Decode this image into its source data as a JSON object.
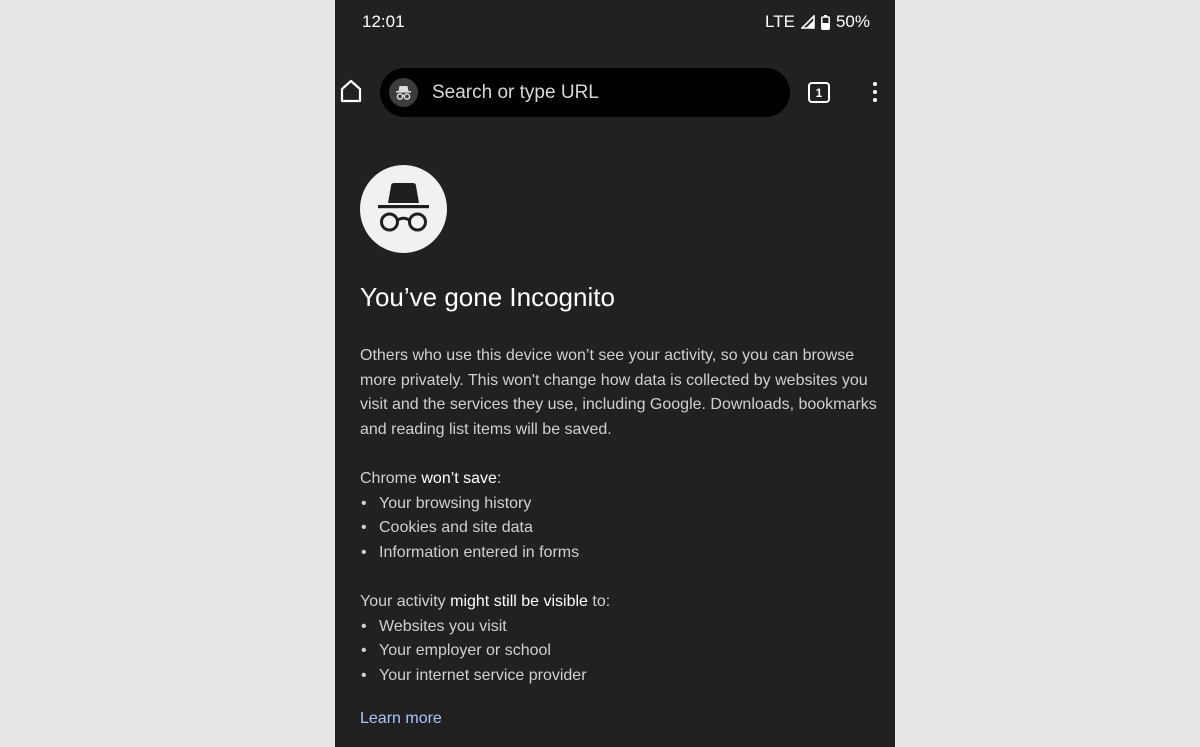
{
  "status_bar": {
    "time": "12:01",
    "network": "LTE",
    "battery": "50%",
    "icons": [
      "signal-icon",
      "battery-icon"
    ]
  },
  "toolbar": {
    "search_placeholder": "Search or type URL",
    "tab_count": "1",
    "icons": [
      "home-icon",
      "incognito-icon",
      "tab-switcher-icon",
      "more-vert-icon"
    ]
  },
  "incognito": {
    "title": "You’ve gone Incognito",
    "description": "Others who use this device won’t see your activity, so you can browse more privately. This won't change how data is collected by websites you visit and the services they use, including Google. Downloads, bookmarks and reading list items will be saved.",
    "wont_save": {
      "prefix": "Chrome ",
      "emphasis": "won’t save",
      "suffix": ":",
      "items": [
        "Your browsing history",
        "Cookies and site data",
        "Information entered in forms"
      ]
    },
    "might_be_visible": {
      "prefix": "Your activity ",
      "emphasis": "might still be visible",
      "suffix": " to:",
      "items": [
        "Websites you visit",
        "Your employer or school",
        "Your internet service provider"
      ]
    },
    "learn_more": "Learn more"
  },
  "colors": {
    "background": "#212121",
    "omnibox": "#000000",
    "link": "#a8c7fa",
    "page_margin": "#e6e6e6"
  }
}
